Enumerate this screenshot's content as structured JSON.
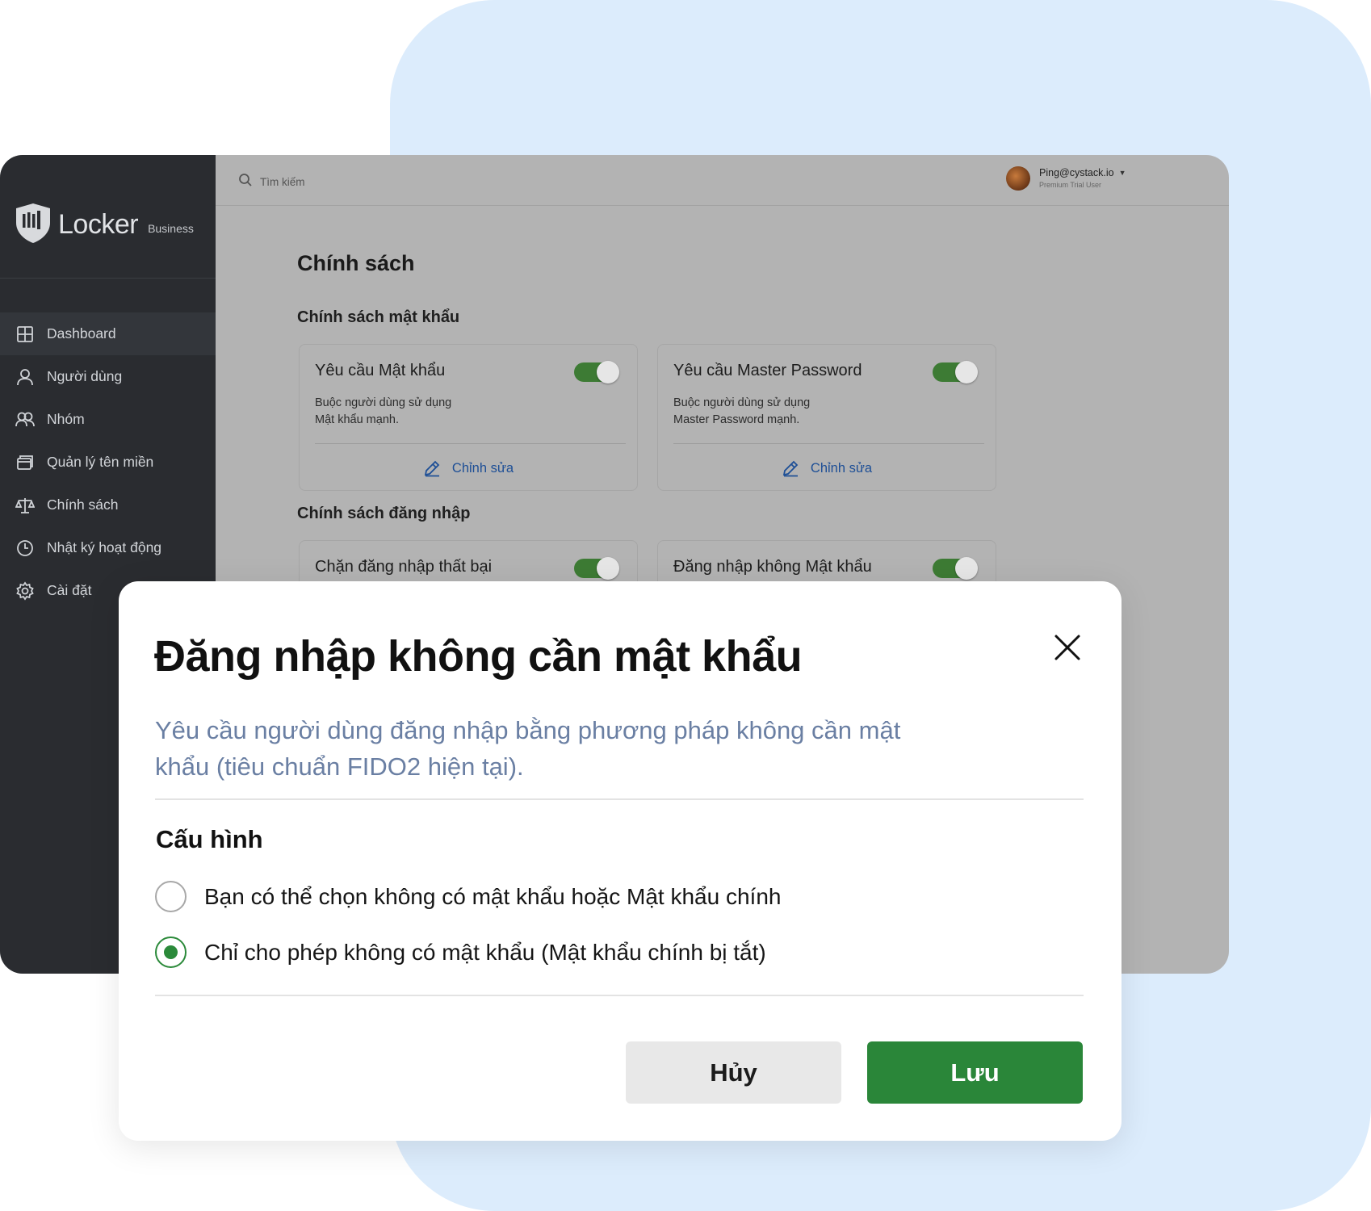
{
  "app": {
    "logo_word": "Locker",
    "logo_sub": "Business"
  },
  "search": {
    "placeholder": "Tìm kiếm"
  },
  "user": {
    "email": "Ping@cystack.io",
    "role": "Premium Trial User"
  },
  "sidebar": {
    "items": [
      {
        "label": "Dashboard",
        "icon": "grid-icon",
        "active": true
      },
      {
        "label": "Người dùng",
        "icon": "user-icon"
      },
      {
        "label": "Nhóm",
        "icon": "group-icon"
      },
      {
        "label": "Quản lý tên miền",
        "icon": "domain-icon"
      },
      {
        "label": "Chính sách",
        "icon": "scale-icon"
      },
      {
        "label": "Nhật ký hoạt động",
        "icon": "clock-icon"
      },
      {
        "label": "Cài đặt",
        "icon": "gear-icon"
      }
    ]
  },
  "main": {
    "page_title": "Chính sách",
    "sections": [
      {
        "title": "Chính sách mật khẩu",
        "cards": [
          {
            "title": "Yêu cầu Mật khẩu",
            "desc_line1": "Buộc người dùng sử dụng",
            "desc_line2": "Mật khẩu mạnh.",
            "edit_label": "Chỉnh sửa",
            "enabled": true
          },
          {
            "title": "Yêu cầu Master Password",
            "desc_line1": "Buộc người dùng sử dụng",
            "desc_line2": "Master Password mạnh.",
            "edit_label": "Chỉnh sửa",
            "enabled": true
          }
        ]
      },
      {
        "title": "Chính sách đăng nhập",
        "cards": [
          {
            "title": "Chặn đăng nhập thất bại",
            "enabled": true
          },
          {
            "title": "Đăng nhập không Mật khẩu",
            "enabled": true
          }
        ]
      }
    ]
  },
  "modal": {
    "title": "Đăng nhập không cần mật khẩu",
    "description": "Yêu cầu người dùng đăng nhập bằng phương pháp không cần mật khẩu (tiêu chuẩn FIDO2 hiện tại).",
    "config_title": "Cấu hình",
    "options": [
      {
        "label": "Bạn có thể chọn không có mật khẩu hoặc Mật khẩu chính",
        "checked": false
      },
      {
        "label": "Chỉ cho phép không có mật khẩu (Mật khẩu chính bị tắt)",
        "checked": true
      }
    ],
    "cancel_label": "Hủy",
    "save_label": "Lưu"
  },
  "colors": {
    "accent_green": "#2a8639",
    "toggle_green": "#3d7b34",
    "link_blue": "#1e4f96",
    "desc_blue_gray": "#6a7fa3",
    "sidebar_bg": "#2a2c30",
    "background_blob": "#dcecfc"
  }
}
